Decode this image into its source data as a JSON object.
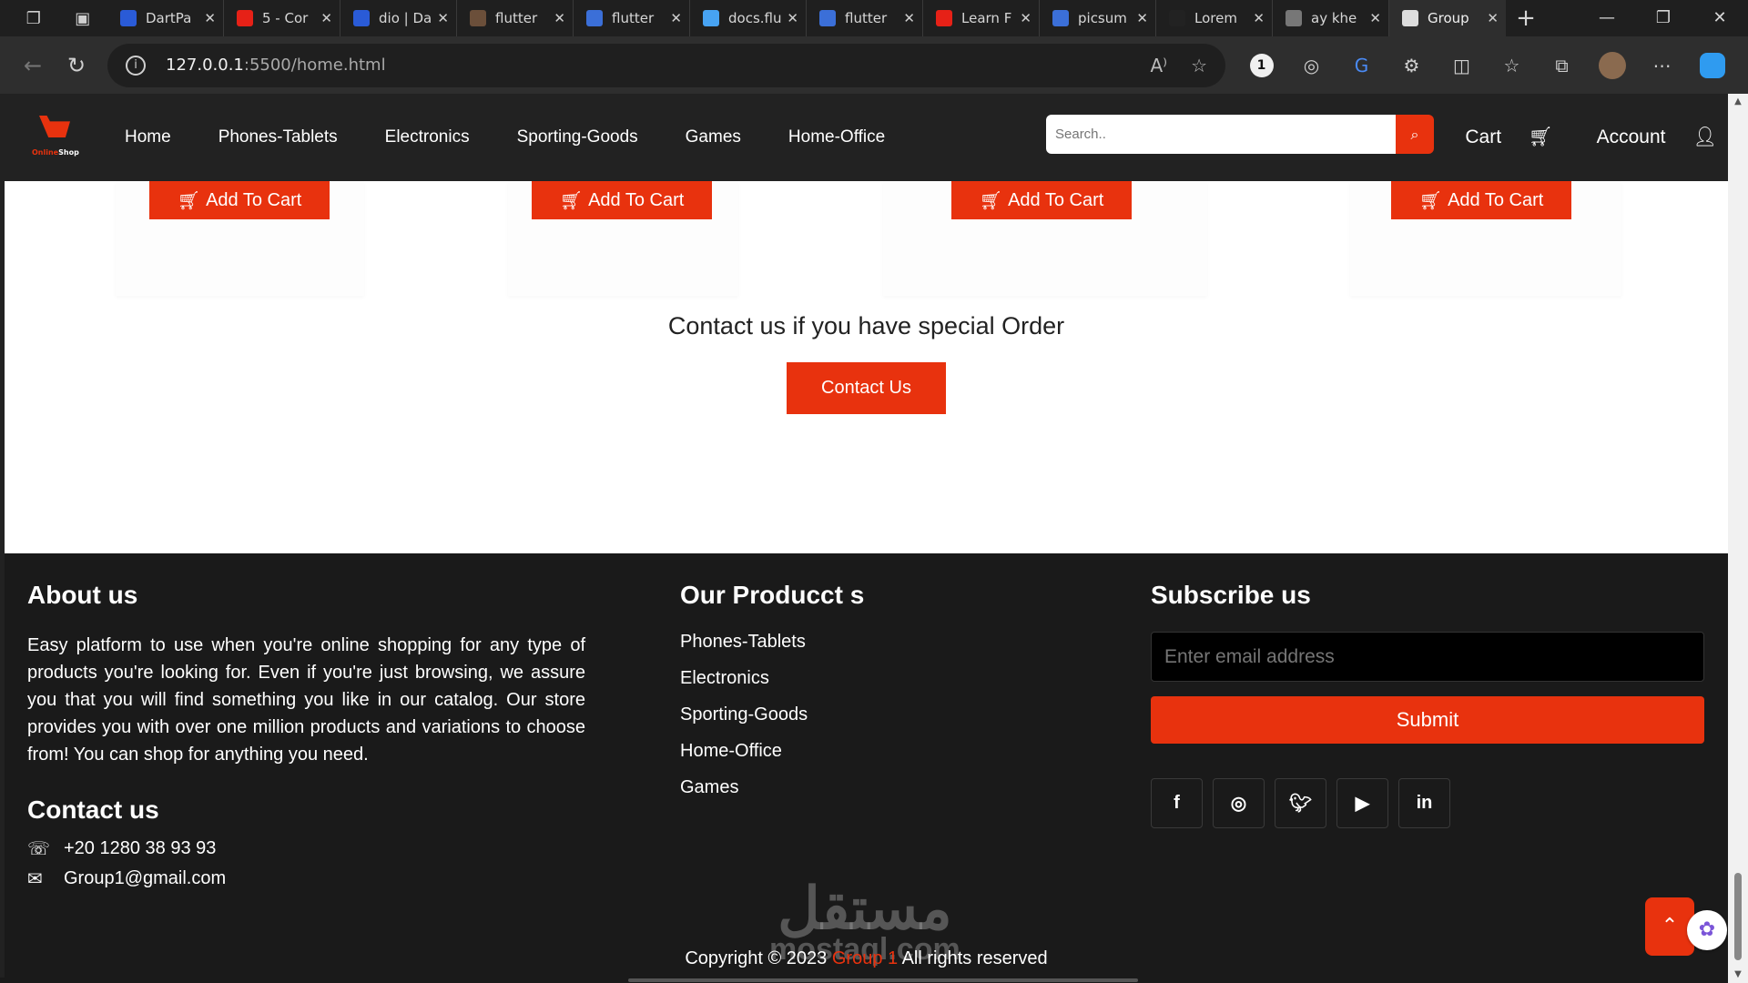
{
  "browser": {
    "tabs": [
      {
        "label": "DartPa",
        "color": "#2a5bd7"
      },
      {
        "label": "5 - Cor",
        "color": "#e62117"
      },
      {
        "label": "dio | Da",
        "color": "#2a5bd7"
      },
      {
        "label": "flutter",
        "color": "#6b4f3a"
      },
      {
        "label": "flutter",
        "color": "#3b6fd8"
      },
      {
        "label": "docs.flu",
        "color": "#47a3f3"
      },
      {
        "label": "flutter",
        "color": "#3b6fd8"
      },
      {
        "label": "Learn F",
        "color": "#e62117"
      },
      {
        "label": "picsum",
        "color": "#3b6fd8"
      },
      {
        "label": "Lorem",
        "color": "#222222"
      },
      {
        "label": "ay khe",
        "color": "#777777"
      },
      {
        "label": "Group",
        "color": "#dddddd"
      }
    ],
    "close_glyph": "✕",
    "new_tab_glyph": "+",
    "url_host": "127.0.0.1",
    "url_path": ":5500/home.html"
  },
  "site": {
    "logo_text_1": "Online",
    "logo_text_2": "Shop",
    "menu": [
      "Home",
      "Phones-Tablets",
      "Electronics",
      "Sporting-Goods",
      "Games",
      "Home-Office"
    ],
    "search_placeholder": "Search..",
    "cart_label": "Cart",
    "account_label": "Account",
    "add_to_cart_label": "Add To Cart",
    "contact_title": "Contact us if you have special Order",
    "contact_button": "Contact Us"
  },
  "footer": {
    "about_title": "About us",
    "about_text": "Easy platform to use when you're online shopping for any type of products you're looking for. Even if you're just browsing, we assure you that you will find something you like in our catalog. Our store provides you with over one million products and variations to choose from! You can shop for anything you need.",
    "contact_title": "Contact us",
    "phone": "+20 1280 38 93 93",
    "email": "Group1@gmail.com",
    "products_title": "Our Producct s",
    "products": [
      "Phones-Tablets",
      "Electronics",
      "Sporting-Goods",
      "Home-Office",
      "Games"
    ],
    "subscribe_title": "Subscribe us",
    "email_placeholder": "Enter email address",
    "submit_label": "Submit",
    "copyright_prefix": "Copyright © 2023",
    "copyright_group": "Group 1",
    "copyright_suffix": "All rights reserved",
    "watermark_ar": "مستقل",
    "watermark_en": "mostaql.com"
  },
  "colors": {
    "accent": "#e8320e",
    "nav_bg": "#222222",
    "footer_bg": "#1a1a1a"
  }
}
